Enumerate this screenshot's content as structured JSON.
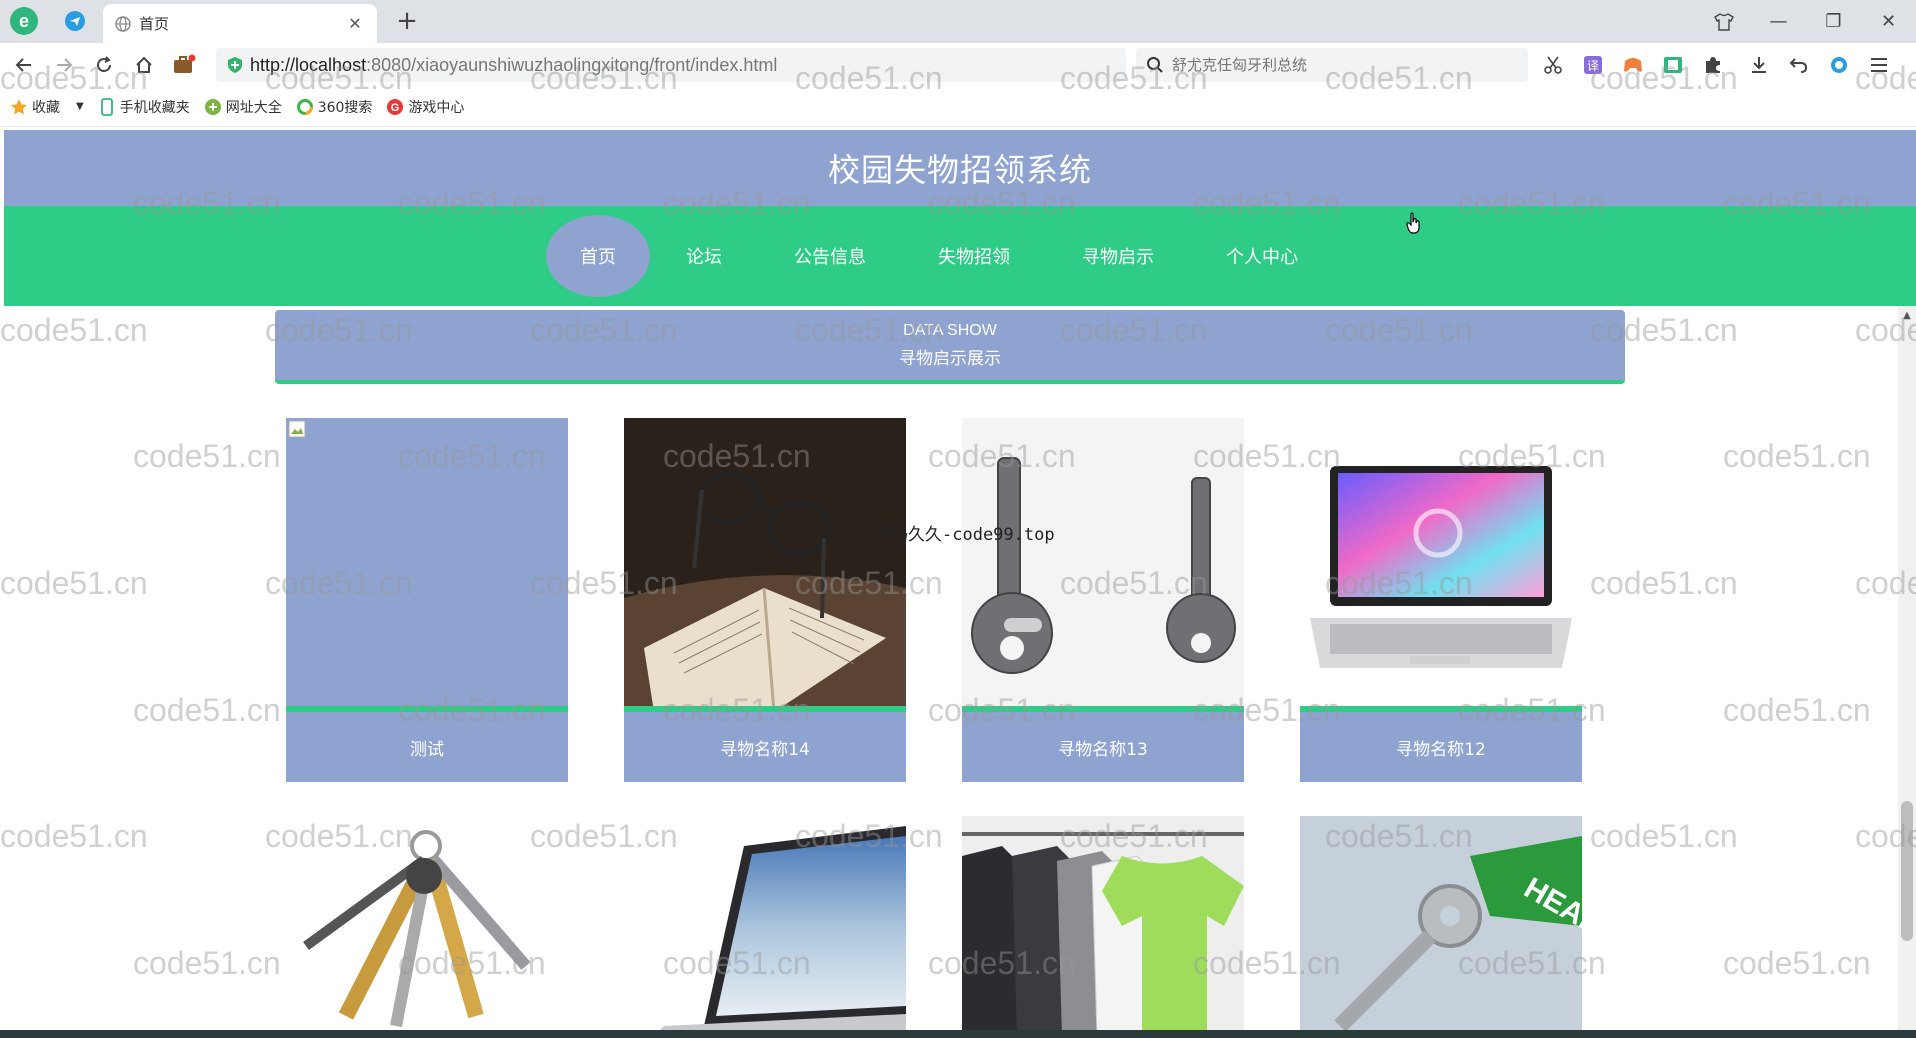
{
  "browser": {
    "tab_title": "首页",
    "url_host": "http://localhost",
    "url_rest": ":8080/xiaoyaunshiwuzhaolingxitong/front/index.html",
    "search_placeholder": "舒尤克任匈牙利总统",
    "bookmarks": [
      "收藏",
      "手机收藏夹",
      "网址大全",
      "360搜索",
      "游戏中心"
    ]
  },
  "site": {
    "title": "校园失物招领系统",
    "nav": [
      "首页",
      "论坛",
      "公告信息",
      "失物招领",
      "寻物启示",
      "个人中心"
    ],
    "banner_en": "DATA SHOW",
    "banner_cn": "寻物启示展示",
    "cards": [
      {
        "caption": "测试"
      },
      {
        "caption": "寻物名称14"
      },
      {
        "caption": "寻物名称13"
      },
      {
        "caption": "寻物名称12"
      }
    ]
  },
  "watermark": "code51.cn",
  "overlay": "源码久久-code99.top"
}
